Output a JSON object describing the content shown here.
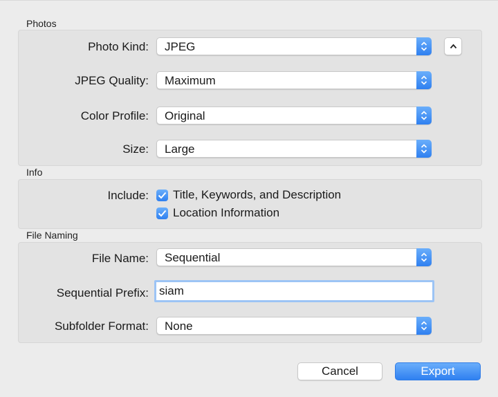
{
  "photos": {
    "section_title": "Photos",
    "photo_kind": {
      "label": "Photo Kind:",
      "value": "JPEG"
    },
    "jpeg_quality": {
      "label": "JPEG Quality:",
      "value": "Maximum"
    },
    "color_profile": {
      "label": "Color Profile:",
      "value": "Original"
    },
    "size": {
      "label": "Size:",
      "value": "Large"
    }
  },
  "info": {
    "section_title": "Info",
    "include_label": "Include:",
    "options": [
      {
        "label": "Title, Keywords, and Description",
        "checked": true
      },
      {
        "label": "Location Information",
        "checked": true
      }
    ]
  },
  "file_naming": {
    "section_title": "File Naming",
    "file_name": {
      "label": "File Name:",
      "value": "Sequential"
    },
    "sequential_prefix": {
      "label": "Sequential Prefix:",
      "value": "siam"
    },
    "subfolder_format": {
      "label": "Subfolder Format:",
      "value": "None"
    }
  },
  "buttons": {
    "cancel": "Cancel",
    "export": "Export"
  },
  "colors": {
    "accent": "#2f80f0",
    "panel": "#e3e3e3",
    "background": "#ececec"
  },
  "icons": {
    "disclosure": "chevron-up-icon",
    "stepper": "up-down-arrows-icon",
    "check": "checkmark-icon"
  }
}
